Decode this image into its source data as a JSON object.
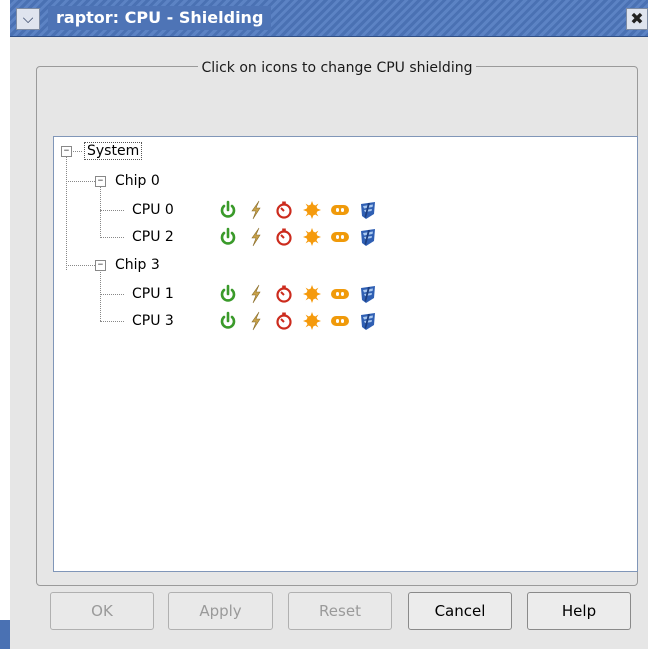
{
  "window": {
    "title": "raptor: CPU - Shielding",
    "menu_icon": "chevron-down-icon",
    "close_icon": "close-icon",
    "menu_glyph": "⌵",
    "close_glyph": "✖"
  },
  "group": {
    "title": "Click on icons to change CPU shielding"
  },
  "tree": {
    "expander_glyph": "−",
    "root": {
      "label": "System"
    },
    "chips": [
      {
        "label": "Chip 0",
        "cpus": [
          "CPU 0",
          "CPU 2"
        ]
      },
      {
        "label": "Chip 3",
        "cpus": [
          "CPU 1",
          "CPU 3"
        ]
      }
    ],
    "cpu_icons": [
      {
        "name": "power-icon",
        "color": "#3a9a2a"
      },
      {
        "name": "lightning-icon",
        "color": "#c8a24a"
      },
      {
        "name": "timer-icon",
        "color": "#cc2b1d"
      },
      {
        "name": "sun-icon",
        "color": "#f59a0c"
      },
      {
        "name": "link-icon",
        "color": "#f09a0a"
      },
      {
        "name": "bolt-shield-icon",
        "color": "#2f5fb3"
      }
    ]
  },
  "buttons": {
    "ok": "OK",
    "apply": "Apply",
    "reset": "Reset",
    "cancel": "Cancel",
    "help": "Help"
  },
  "colors": {
    "titlebar": "#4a71b3",
    "dialog_bg": "#e6e6e6",
    "tree_border": "#8096b8"
  }
}
